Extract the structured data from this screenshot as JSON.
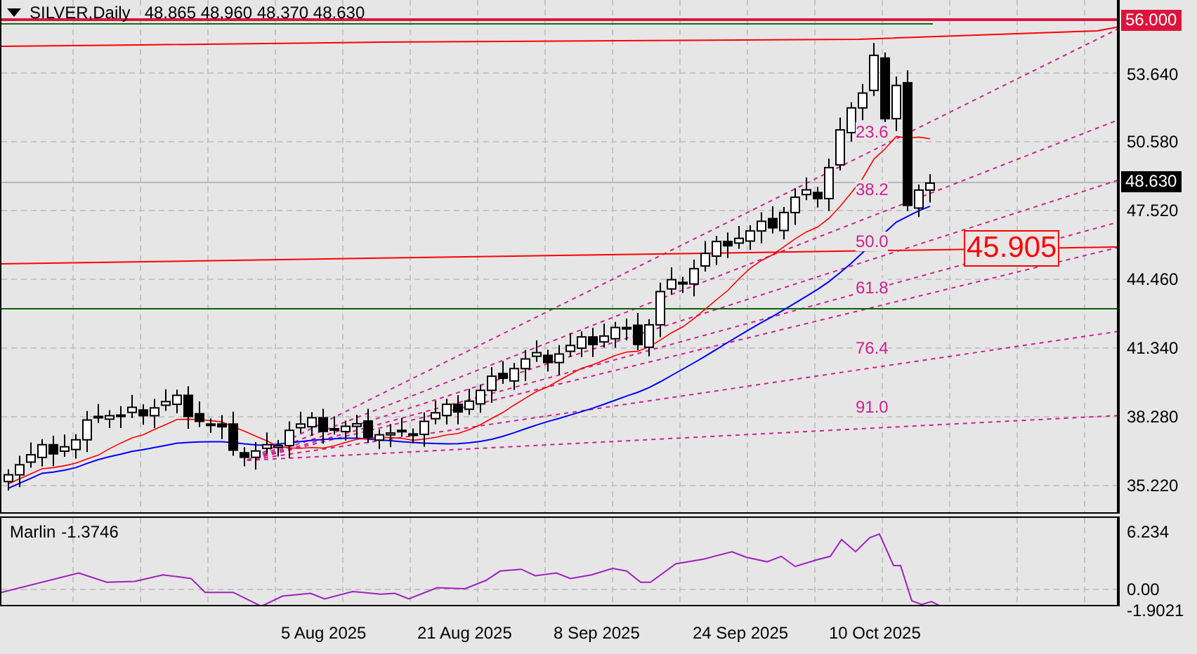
{
  "chart": {
    "symbol": "SILVER,Daily",
    "ohlc": "48.865 48.960 48.370 48.630",
    "top_level_tag": "56.000",
    "price_axis": [
      "53.640",
      "50.580",
      "47.520",
      "44.460",
      "41.340",
      "38.280",
      "35.220"
    ],
    "current_price_tag": "48.630",
    "fib_labels": [
      "23.6",
      "38.2",
      "50.0",
      "61.8",
      "76.4",
      "91.0"
    ],
    "level_box": "45.905"
  },
  "indicator": {
    "name": "Marlin",
    "value": "-1.3746",
    "scale": [
      "6.234",
      "0.00",
      "-1.9021"
    ]
  },
  "date_axis": [
    "5 Aug 2025",
    "21 Aug 2025",
    "8 Sep 2025",
    "24 Sep 2025",
    "10 Oct 2025"
  ]
}
